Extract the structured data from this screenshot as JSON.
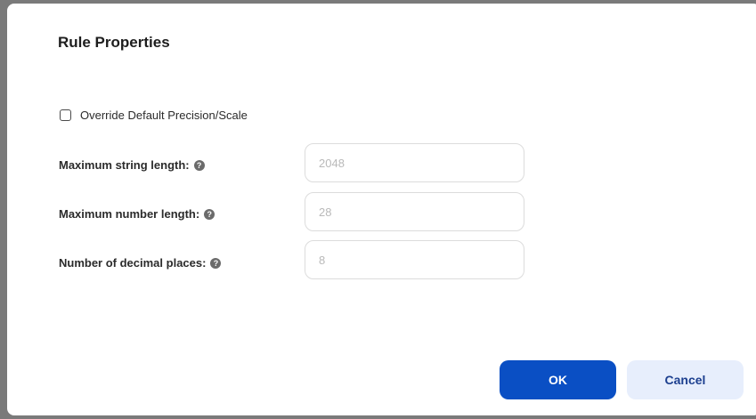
{
  "dialog": {
    "title": "Rule Properties",
    "override_checkbox": {
      "label": "Override Default Precision/Scale",
      "checked": false
    },
    "fields": [
      {
        "label": "Maximum string length:",
        "help_icon": "question-circle-icon",
        "value": "2048"
      },
      {
        "label": "Maximum number length:",
        "help_icon": "question-circle-icon",
        "value": "28"
      },
      {
        "label": "Number of decimal places:",
        "help_icon": "question-circle-icon",
        "value": "8"
      }
    ],
    "buttons": {
      "ok_label": "OK",
      "cancel_label": "Cancel"
    }
  },
  "colors": {
    "primary": "#0a4fc4",
    "secondary_bg": "#e7eefc",
    "secondary_text": "#1c3f8f",
    "input_text": "#b9b9b9"
  }
}
